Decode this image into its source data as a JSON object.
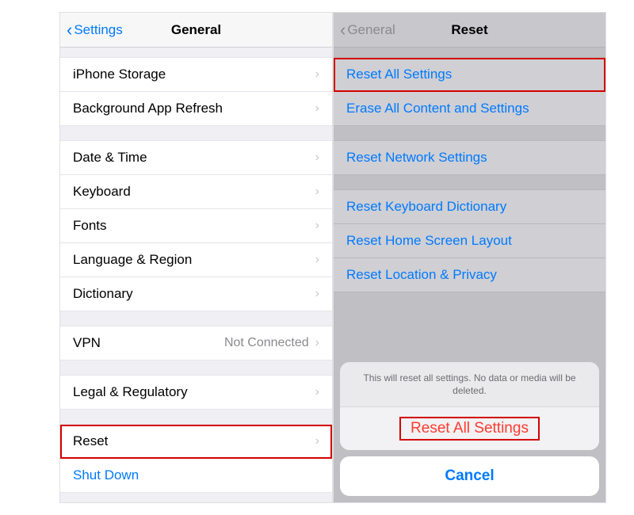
{
  "left": {
    "back_label": "Settings",
    "title": "General",
    "g1": [
      {
        "label": "iPhone Storage"
      },
      {
        "label": "Background App Refresh"
      }
    ],
    "g2": [
      {
        "label": "Date & Time"
      },
      {
        "label": "Keyboard"
      },
      {
        "label": "Fonts"
      },
      {
        "label": "Language & Region"
      },
      {
        "label": "Dictionary"
      }
    ],
    "g3": [
      {
        "label": "VPN",
        "detail": "Not Connected"
      }
    ],
    "g4": [
      {
        "label": "Legal & Regulatory"
      }
    ],
    "g5": [
      {
        "label": "Reset",
        "highlight": true
      },
      {
        "label": "Shut Down",
        "link": true
      }
    ]
  },
  "right": {
    "back_label": "General",
    "title": "Reset",
    "g1": [
      {
        "label": "Reset All Settings",
        "highlight": true
      },
      {
        "label": "Erase All Content and Settings"
      }
    ],
    "g2": [
      {
        "label": "Reset Network Settings"
      }
    ],
    "g3": [
      {
        "label": "Reset Keyboard Dictionary"
      },
      {
        "label": "Reset Home Screen Layout"
      },
      {
        "label": "Reset Location & Privacy"
      }
    ],
    "sheet": {
      "message": "This will reset all settings. No data or media will be deleted.",
      "destructive": "Reset All Settings",
      "cancel": "Cancel"
    }
  }
}
